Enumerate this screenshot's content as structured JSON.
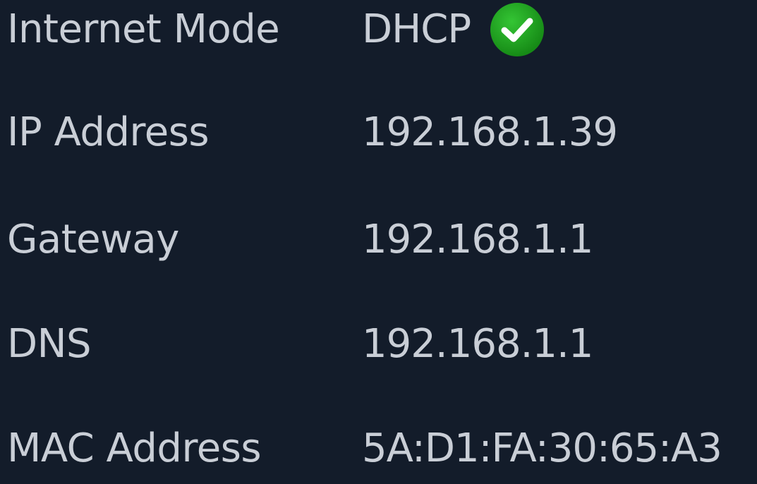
{
  "network_info": {
    "rows": [
      {
        "label": "Internet Mode",
        "value": "DHCP",
        "status_icon": "check-circle-icon",
        "status_color": "#1fa11f"
      },
      {
        "label": "IP Address",
        "value": "192.168.1.39"
      },
      {
        "label": "Gateway",
        "value": "192.168.1.1"
      },
      {
        "label": "DNS",
        "value": "192.168.1.1"
      },
      {
        "label": "MAC Address",
        "value": "5A:D1:FA:30:65:A3"
      }
    ]
  }
}
